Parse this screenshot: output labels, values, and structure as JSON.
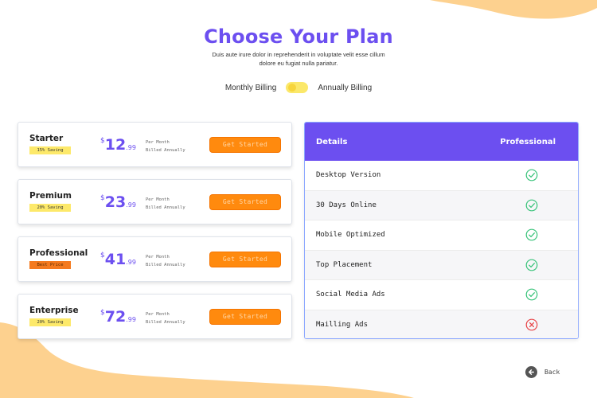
{
  "header": {
    "title": "Choose Your Plan",
    "subtitle": "Duis aute irure dolor in reprehenderit in voluptate velit esse cillum dolore eu fugiat nulla pariatur."
  },
  "billing": {
    "monthly_label": "Monthly Billing",
    "annual_label": "Annually Billing"
  },
  "plans": [
    {
      "name": "Starter",
      "badge": "15% Saving",
      "currency": "$",
      "amount": "12",
      "cents": ".99",
      "per_line1": "Per Month",
      "per_line2": "Billed Annually",
      "cta": "Get Started"
    },
    {
      "name": "Premium",
      "badge": "20% Saving",
      "currency": "$",
      "amount": "23",
      "cents": ".99",
      "per_line1": "Per Month",
      "per_line2": "Billed Annually",
      "cta": "Get Started"
    },
    {
      "name": "Professional",
      "badge": "Best Price",
      "currency": "$",
      "amount": "41",
      "cents": ".99",
      "per_line1": "Per Month",
      "per_line2": "Billed Annually",
      "cta": "Get Started"
    },
    {
      "name": "Enterprise",
      "badge": "20% Saving",
      "currency": "$",
      "amount": "72",
      "cents": ".99",
      "per_line1": "Per Month",
      "per_line2": "Billed Annually",
      "cta": "Get Started"
    }
  ],
  "details": {
    "header_label": "Details",
    "plan_label": "Professional",
    "features": [
      {
        "name": "Desktop Version",
        "included": true,
        "icon": "check-circle-icon"
      },
      {
        "name": "30 Days Online",
        "included": true,
        "icon": "check-circle-icon"
      },
      {
        "name": "Mobile Optimized",
        "included": true,
        "icon": "check-circle-icon"
      },
      {
        "name": "Top Placement",
        "included": true,
        "icon": "check-circle-icon"
      },
      {
        "name": "Social Media Ads",
        "included": true,
        "icon": "check-circle-icon"
      },
      {
        "name": "Mailling Ads",
        "included": false,
        "icon": "x-circle-icon"
      }
    ]
  },
  "footer": {
    "back_label": "Back",
    "back_icon": "arrow-left-icon"
  },
  "colors": {
    "accent": "#6c4ff0",
    "cta": "#ff8a0e",
    "badge": "#fde96a",
    "badge_hot": "#f47a1e",
    "blob": "#fdd18f",
    "check": "#3cc47c",
    "cross": "#e8474a"
  }
}
